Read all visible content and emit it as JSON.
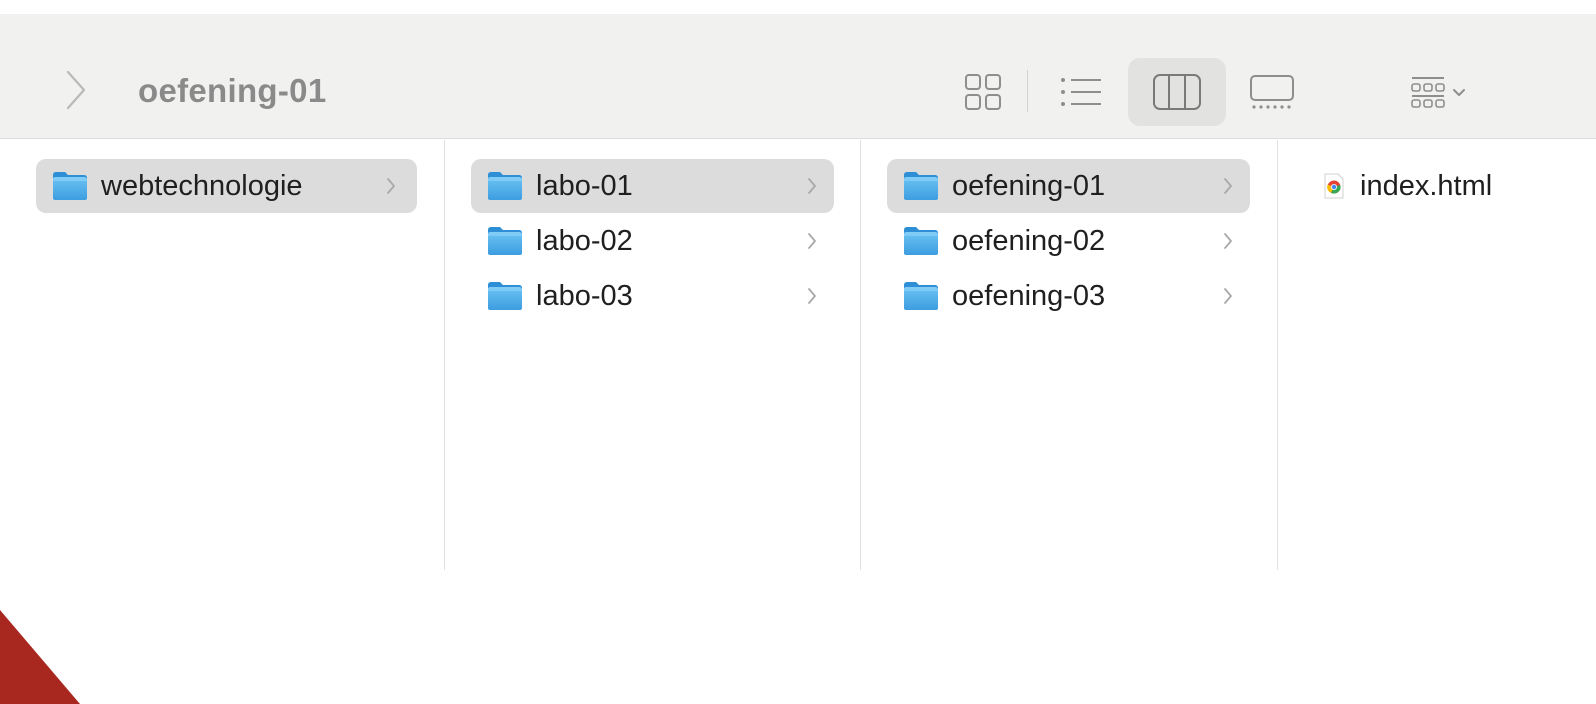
{
  "toolbar": {
    "title": "oefening-01",
    "back_icon": "chevron-left-icon",
    "view_buttons": [
      {
        "name": "icon-view",
        "icon": "grid-icon"
      },
      {
        "name": "list-view",
        "icon": "list-icon"
      },
      {
        "name": "column-view",
        "icon": "columns-icon",
        "selected": true
      },
      {
        "name": "gallery-view",
        "icon": "gallery-icon"
      }
    ],
    "group_icon": "group-grid-icon",
    "group_dropdown_icon": "chevron-down-icon"
  },
  "columns": [
    {
      "items": [
        {
          "label": "webtechnologie",
          "type": "folder",
          "selected": true
        }
      ]
    },
    {
      "items": [
        {
          "label": "labo-01",
          "type": "folder",
          "selected": true
        },
        {
          "label": "labo-02",
          "type": "folder",
          "selected": false
        },
        {
          "label": "labo-03",
          "type": "folder",
          "selected": false
        }
      ]
    },
    {
      "items": [
        {
          "label": "oefening-01",
          "type": "folder",
          "selected": true
        },
        {
          "label": "oefening-02",
          "type": "folder",
          "selected": false
        },
        {
          "label": "oefening-03",
          "type": "folder",
          "selected": false
        }
      ]
    },
    {
      "items": [
        {
          "label": "index.html",
          "type": "file",
          "icon": "chrome-html-icon"
        }
      ]
    }
  ],
  "colors": {
    "toolbar_bg": "#f1f1f0",
    "selection_bg": "#dcdcdc",
    "folder_blue": "#5fb4ec",
    "corner_red": "#a8281f"
  }
}
